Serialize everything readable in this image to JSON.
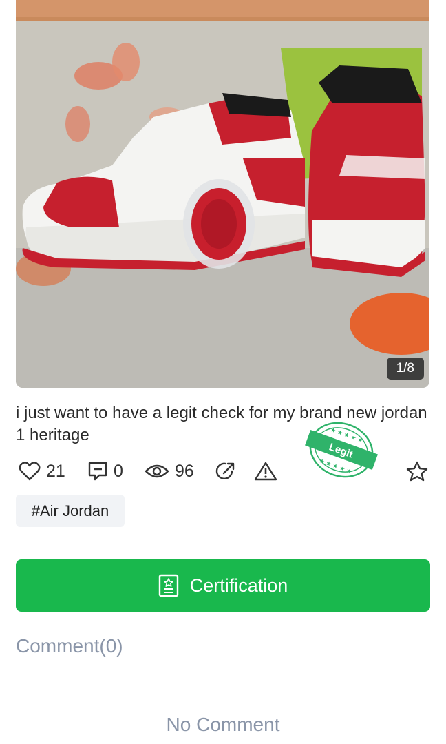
{
  "photo": {
    "counter": "1/8"
  },
  "post": {
    "text": "i just want to have a legit check for my brand new jordan 1 heritage"
  },
  "stats": {
    "likes": "21",
    "comments": "0",
    "views": "96"
  },
  "stamp": {
    "label": "Legit"
  },
  "tags": [
    "#Air Jordan"
  ],
  "certification": {
    "label": "Certification"
  },
  "comments_section": {
    "title": "Comment(0)",
    "empty": "No Comment"
  },
  "colors": {
    "accent": "#19b84d",
    "muted": "#8a95a8",
    "stamp": "#2fb36a"
  }
}
